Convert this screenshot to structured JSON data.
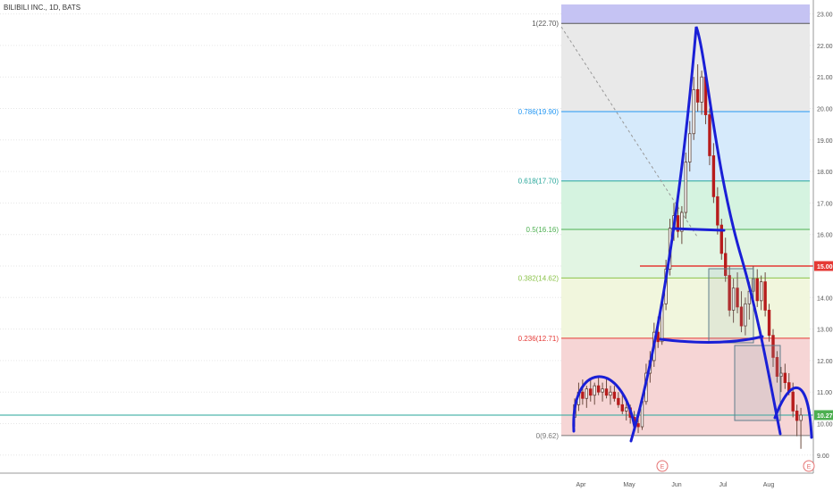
{
  "symbol_title": "BILIBILI INC., 1D, BATS",
  "chart_data": {
    "type": "candlestick",
    "title": "BILIBILI INC., 1D, BATS",
    "ylim": [
      8.6,
      23.3
    ],
    "y_ticks": [
      "9.00",
      "10.00",
      "11.00",
      "12.00",
      "13.00",
      "14.00",
      "15.00",
      "16.00",
      "17.00",
      "18.00",
      "19.00",
      "20.00",
      "21.00",
      "22.00",
      "23.00"
    ],
    "x_ticks": [
      "Apr",
      "May",
      "Jun",
      "Jul",
      "Aug"
    ],
    "event_markers": [
      {
        "label": "E",
        "date": "Jun"
      },
      {
        "label": "E",
        "date": "late Aug"
      }
    ],
    "price_badges": [
      {
        "label": "15.00",
        "value": 15.0,
        "color": "#e53935"
      },
      {
        "label": "10.27",
        "value": 10.27,
        "color": "#4caf50"
      }
    ],
    "horizontal_lines": [
      {
        "value": 15.0,
        "color": "#e53935"
      },
      {
        "value": 10.27,
        "color": "#26a69a"
      }
    ],
    "fibonacci_levels": [
      {
        "label": "1(22.70)",
        "value": 22.7,
        "color": "#555555"
      },
      {
        "label": "0.786(19.90)",
        "value": 19.9,
        "color": "#2196f3"
      },
      {
        "label": "0.618(17.70)",
        "value": 17.7,
        "color": "#26a69a"
      },
      {
        "label": "0.5(16.16)",
        "value": 16.16,
        "color": "#4caf50"
      },
      {
        "label": "0.382(14.62)",
        "value": 14.62,
        "color": "#8bc34a"
      },
      {
        "label": "0.236(12.71)",
        "value": 12.71,
        "color": "#e53935"
      },
      {
        "label": "0(9.62)",
        "value": 9.62,
        "color": "#777777"
      }
    ],
    "fib_zones": [
      {
        "from": 22.7,
        "to": 23.3,
        "color": "#c5c3f3"
      },
      {
        "from": 19.9,
        "to": 22.7,
        "color": "#e9e9e9"
      },
      {
        "from": 17.7,
        "to": 19.9,
        "color": "#d6eafb"
      },
      {
        "from": 16.16,
        "to": 17.7,
        "color": "#d5f3e0"
      },
      {
        "from": 14.62,
        "to": 16.16,
        "color": "#e2f5e3"
      },
      {
        "from": 12.71,
        "to": 14.62,
        "color": "#f1f6dd"
      },
      {
        "from": 9.62,
        "to": 12.71,
        "color": "#f6d5d5"
      }
    ],
    "candles": [
      [
        10.2,
        10.8,
        9.9,
        10.6
      ],
      [
        10.6,
        11.3,
        10.4,
        11.0
      ],
      [
        11.0,
        11.4,
        10.6,
        10.8
      ],
      [
        10.8,
        11.2,
        10.5,
        11.1
      ],
      [
        11.1,
        11.4,
        10.7,
        10.9
      ],
      [
        10.9,
        11.3,
        10.6,
        11.2
      ],
      [
        11.2,
        11.5,
        10.9,
        11.0
      ],
      [
        11.0,
        11.3,
        10.7,
        11.1
      ],
      [
        11.1,
        11.4,
        10.8,
        10.9
      ],
      [
        10.9,
        11.2,
        10.6,
        11.0
      ],
      [
        11.0,
        11.2,
        10.7,
        10.8
      ],
      [
        10.8,
        11.0,
        10.5,
        10.6
      ],
      [
        10.6,
        10.9,
        10.3,
        10.4
      ],
      [
        10.4,
        10.7,
        10.1,
        10.5
      ],
      [
        10.5,
        10.6,
        10.0,
        10.2
      ],
      [
        10.2,
        10.4,
        9.8,
        10.0
      ],
      [
        10.0,
        10.3,
        9.7,
        9.9
      ],
      [
        9.9,
        10.8,
        9.8,
        10.7
      ],
      [
        10.7,
        11.9,
        10.6,
        11.6
      ],
      [
        11.6,
        12.3,
        11.3,
        12.0
      ],
      [
        12.0,
        13.2,
        11.8,
        12.9
      ],
      [
        12.9,
        13.4,
        12.4,
        12.6
      ],
      [
        12.6,
        14.0,
        12.5,
        13.8
      ],
      [
        13.8,
        15.2,
        13.6,
        14.9
      ],
      [
        14.9,
        16.5,
        14.7,
        16.2
      ],
      [
        16.2,
        17.0,
        15.8,
        16.6
      ],
      [
        16.6,
        17.2,
        15.9,
        16.1
      ],
      [
        16.1,
        16.9,
        15.7,
        16.7
      ],
      [
        16.7,
        18.6,
        16.5,
        18.3
      ],
      [
        18.3,
        19.6,
        18.0,
        19.2
      ],
      [
        19.2,
        21.0,
        19.0,
        20.6
      ],
      [
        20.6,
        21.4,
        19.9,
        20.2
      ],
      [
        20.2,
        21.2,
        19.8,
        21.0
      ],
      [
        21.0,
        21.3,
        19.5,
        19.8
      ],
      [
        19.8,
        20.0,
        18.2,
        18.5
      ],
      [
        18.5,
        18.9,
        17.0,
        17.2
      ],
      [
        17.2,
        17.5,
        16.0,
        16.3
      ],
      [
        16.3,
        16.5,
        15.2,
        15.4
      ],
      [
        15.4,
        15.9,
        14.5,
        14.7
      ],
      [
        14.7,
        15.0,
        13.4,
        13.6
      ],
      [
        13.6,
        14.6,
        13.2,
        14.3
      ],
      [
        14.3,
        14.8,
        13.5,
        13.7
      ],
      [
        13.7,
        14.2,
        12.9,
        13.1
      ],
      [
        13.1,
        14.0,
        12.8,
        13.8
      ],
      [
        13.8,
        14.5,
        13.3,
        14.2
      ],
      [
        14.2,
        15.0,
        13.9,
        14.6
      ],
      [
        14.6,
        14.9,
        13.7,
        13.9
      ],
      [
        13.9,
        14.7,
        13.6,
        14.5
      ],
      [
        14.5,
        14.8,
        13.4,
        13.6
      ],
      [
        13.6,
        13.8,
        12.6,
        12.8
      ],
      [
        12.8,
        13.0,
        11.8,
        12.1
      ],
      [
        12.1,
        12.3,
        11.3,
        11.5
      ],
      [
        11.5,
        11.8,
        11.0,
        11.6
      ],
      [
        11.6,
        11.9,
        11.1,
        11.3
      ],
      [
        11.3,
        11.6,
        10.9,
        11.0
      ],
      [
        11.0,
        11.3,
        10.2,
        10.4
      ],
      [
        10.4,
        10.6,
        9.6,
        10.1
      ],
      [
        10.1,
        10.5,
        9.2,
        10.27
      ]
    ]
  }
}
